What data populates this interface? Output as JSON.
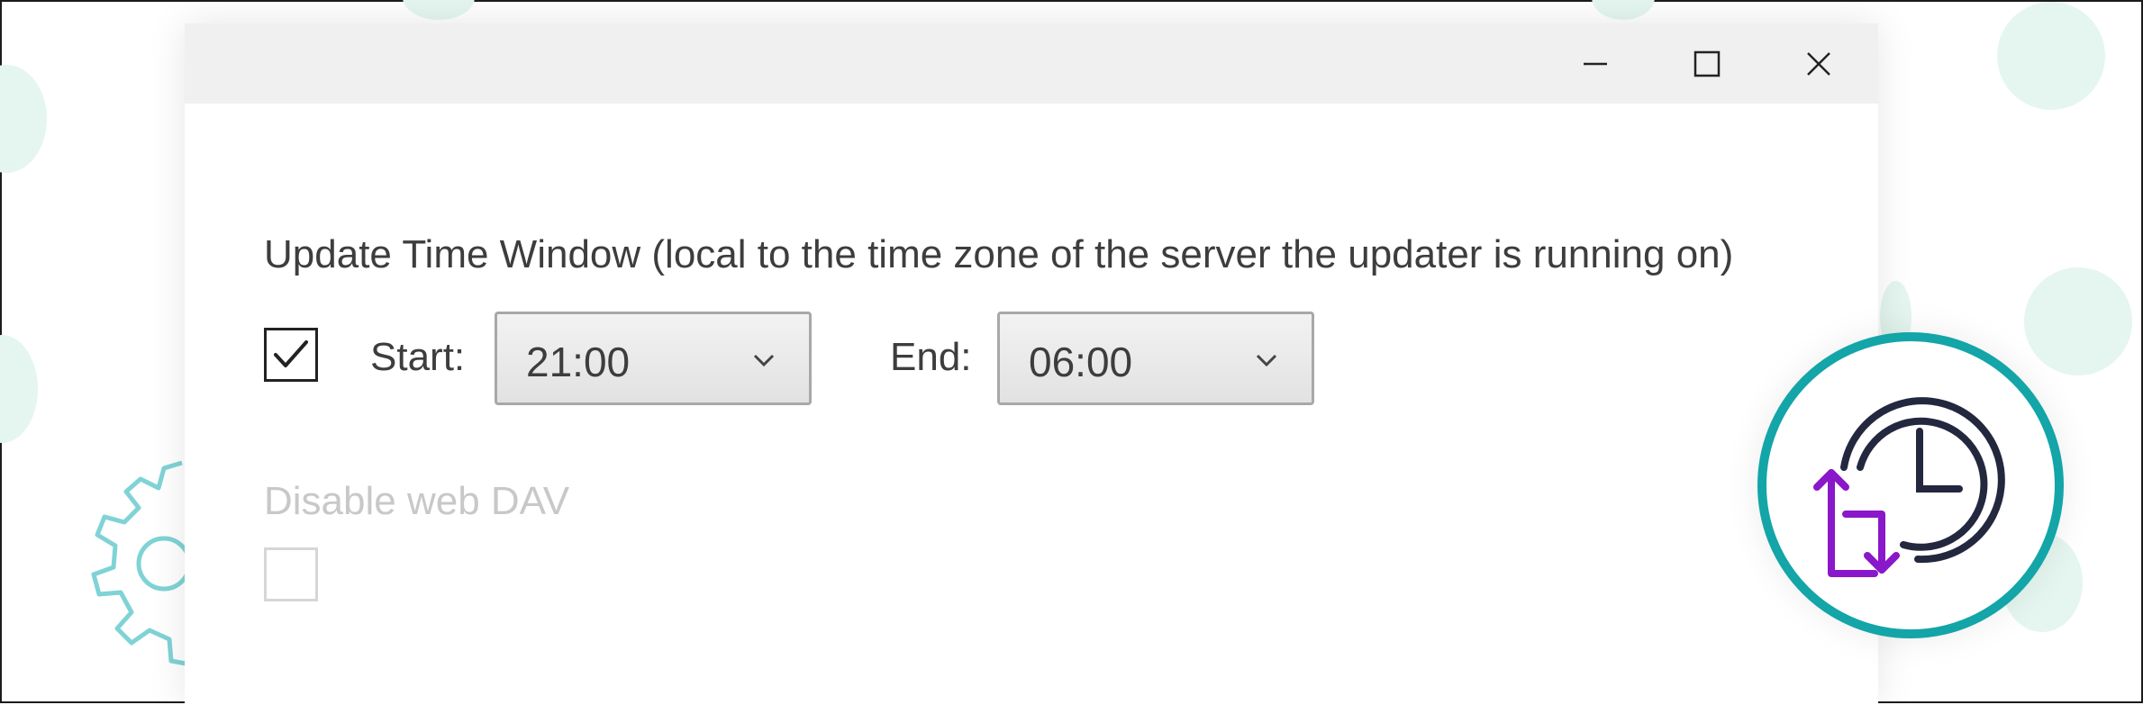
{
  "window": {
    "controls": {
      "minimize_icon": "minimize-icon",
      "maximize_icon": "maximize-icon",
      "close_icon": "close-icon"
    }
  },
  "update_window": {
    "heading": "Update Time Window (local to the time zone of the server the updater is running on)",
    "enabled": true,
    "start_label": "Start:",
    "start_value": "21:00",
    "end_label": "End:",
    "end_value": "06:00"
  },
  "webdav": {
    "label": "Disable web DAV",
    "checked": false,
    "disabled": true
  },
  "colors": {
    "badge_ring": "#13a5a8",
    "clock": "#23283f",
    "sync_arrows": "#8a17c9",
    "background_dots": "#e4f6ef",
    "gear_outline": "#7fd3d6"
  },
  "decorations": {
    "badge_icon": "clock-sync-icon",
    "gear_icon": "gear-icon"
  }
}
